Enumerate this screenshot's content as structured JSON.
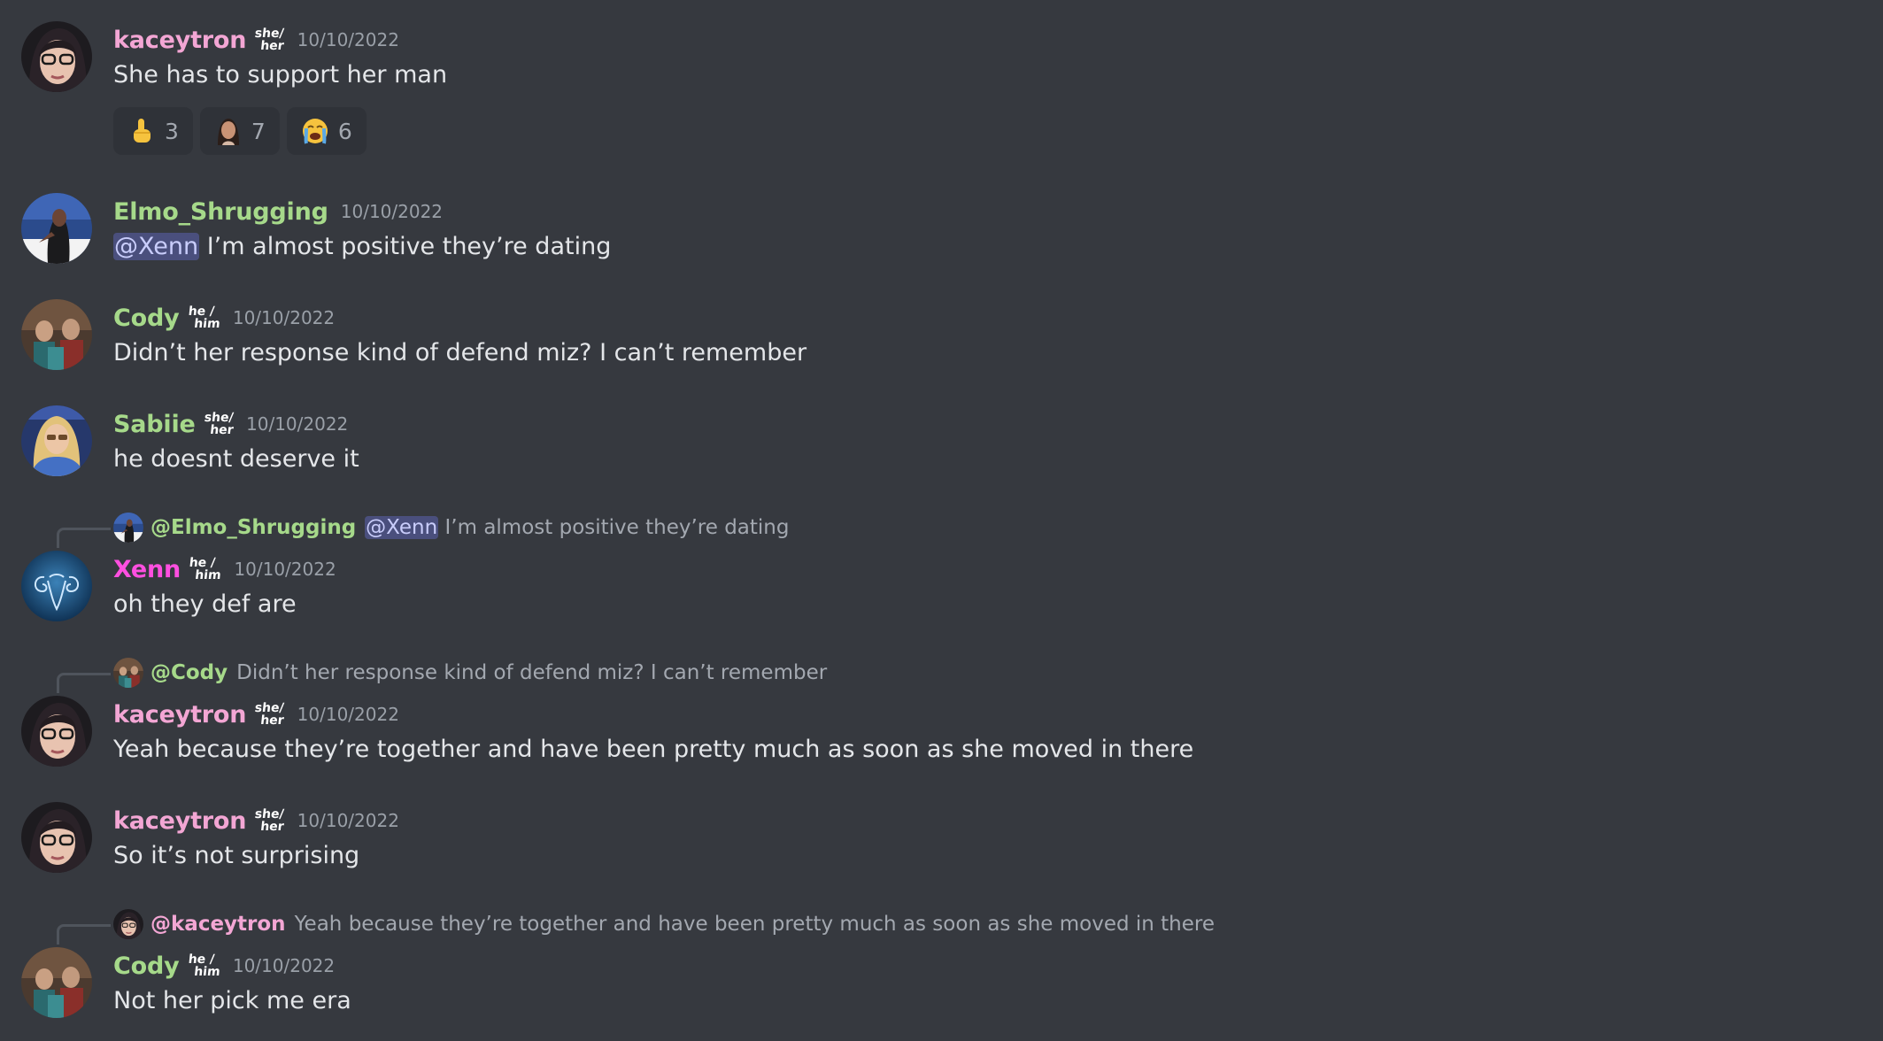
{
  "pronouns": {
    "she_her": [
      "she/",
      "her"
    ],
    "he_him": [
      "he /",
      "him"
    ]
  },
  "colors": {
    "background": "#36393f",
    "kaceytron": "#f3a6d4",
    "green_users": "#a6d98a",
    "xenn": "#ff4fe0",
    "mention_bg": "#4a4f7d"
  },
  "messages": [
    {
      "author": "kaceytron",
      "timestamp": "10/10/2022",
      "text": "She has to support her man",
      "reactions": [
        {
          "emoji": "point-up-emoji",
          "count": "3"
        },
        {
          "emoji": "woman-face-emoji",
          "count": "7"
        },
        {
          "emoji": "crying-face-emoji",
          "count": "6"
        }
      ]
    },
    {
      "author": "Elmo_Shrugging",
      "timestamp": "10/10/2022",
      "mention": "@Xenn",
      "text": "I’m almost positive they’re dating"
    },
    {
      "author": "Cody",
      "timestamp": "10/10/2022",
      "text": "Didn’t her response kind of defend miz? I can’t remember"
    },
    {
      "author": "Sabiie",
      "timestamp": "10/10/2022",
      "text": "he doesnt deserve it"
    },
    {
      "reply_to": {
        "author": "@Elmo_Shrugging",
        "mention": "@Xenn",
        "text": "I’m almost positive they’re dating"
      },
      "author": "Xenn",
      "timestamp": "10/10/2022",
      "text": "oh they def are"
    },
    {
      "reply_to": {
        "author": "@Cody",
        "text": "Didn’t her response kind of defend miz? I can’t remember"
      },
      "author": "kaceytron",
      "timestamp": "10/10/2022",
      "text": "Yeah because they’re together and have been pretty much as soon as she moved in there"
    },
    {
      "author": "kaceytron",
      "timestamp": "10/10/2022",
      "text": "So it’s not surprising"
    },
    {
      "reply_to": {
        "author": "@kaceytron",
        "text": "Yeah because they’re together and have been pretty much as soon as she moved in there"
      },
      "author": "Cody",
      "timestamp": "10/10/2022",
      "text": "Not her pick me era"
    }
  ]
}
